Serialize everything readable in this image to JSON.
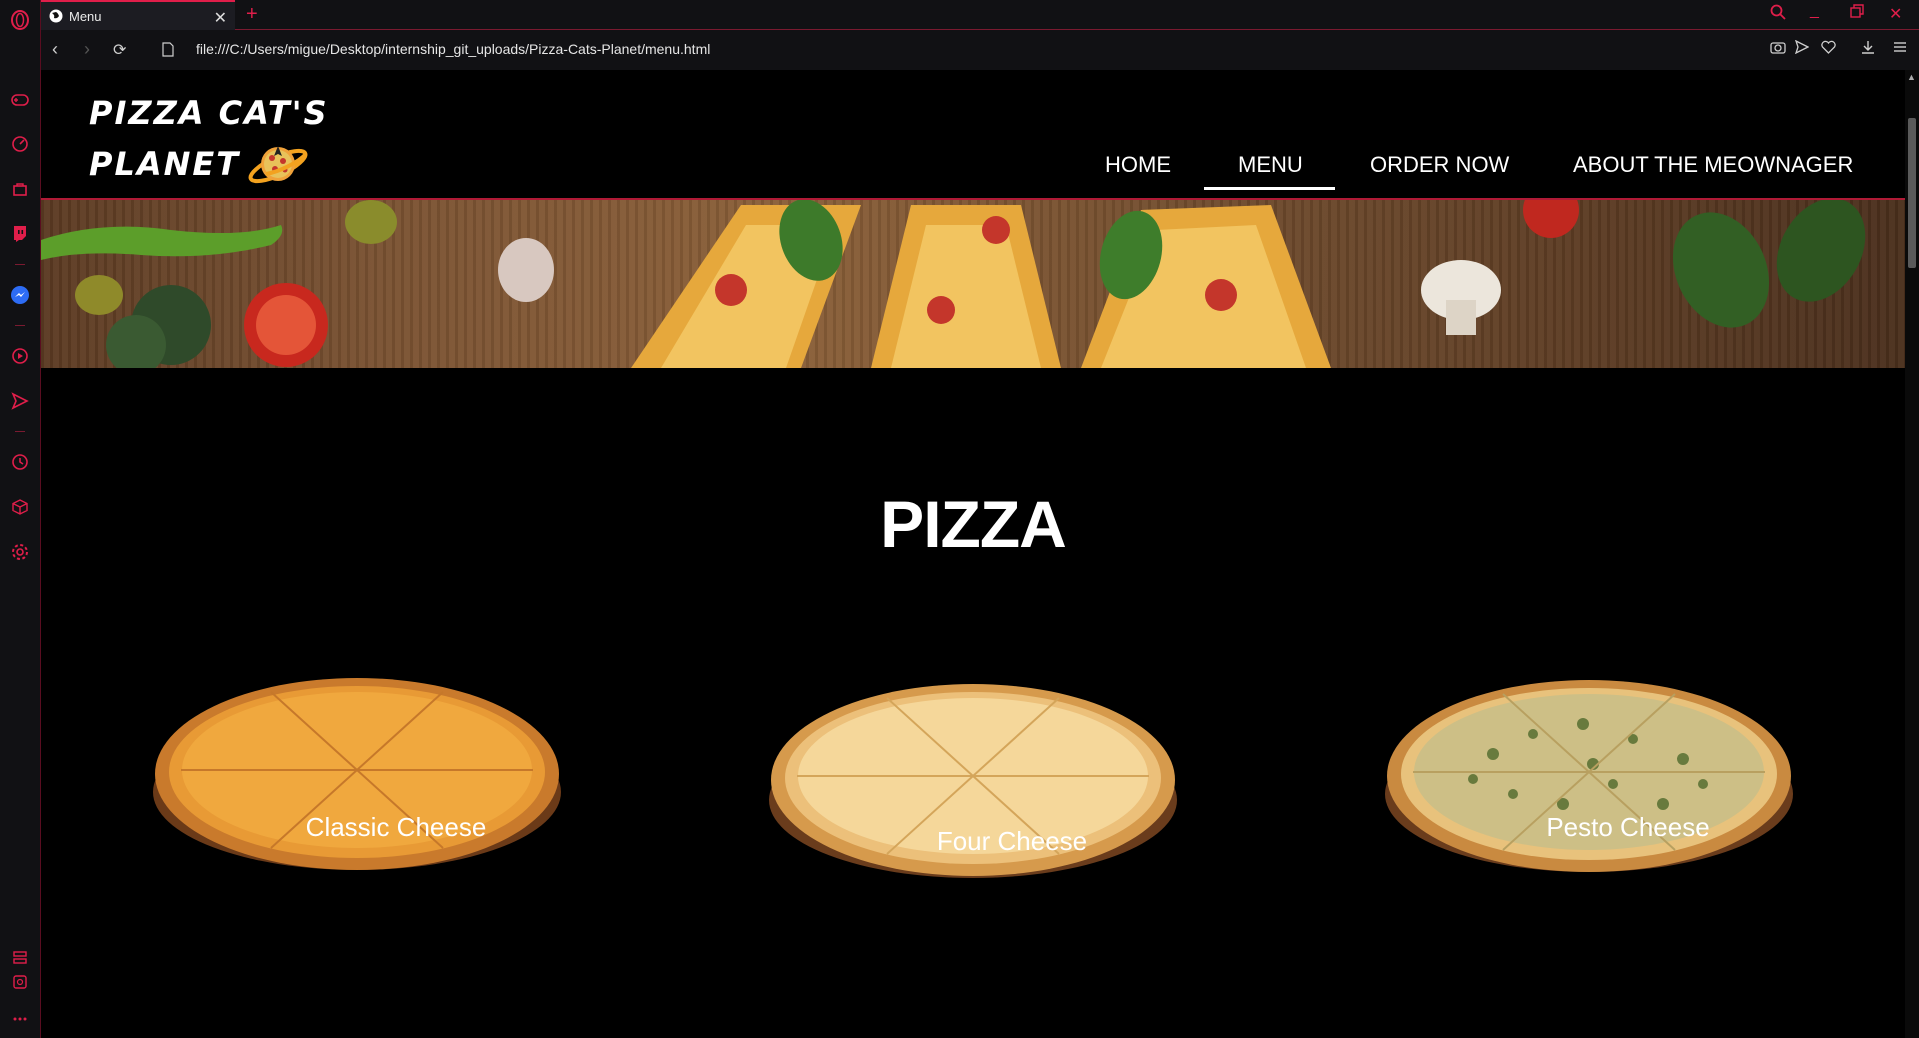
{
  "browser": {
    "tab_title": "Menu",
    "new_tab": "+",
    "url": "file:///C:/Users/migue/Desktop/internship_git_uploads/Pizza-Cats-Planet/menu.html"
  },
  "site": {
    "logo_line1": "PIZZA CAT'S",
    "logo_line2": "PLANET",
    "nav": [
      {
        "label": "HOME"
      },
      {
        "label": "MENU"
      },
      {
        "label": "ORDER NOW"
      },
      {
        "label": "ABOUT THE MEOWNAGER"
      }
    ],
    "section_title": "PIZZA",
    "pizzas": [
      {
        "name": "Classic Cheese"
      },
      {
        "name": "Four Cheese"
      },
      {
        "name": "Pesto Cheese"
      }
    ]
  },
  "colors": {
    "accent": "#e01e4a",
    "header_border": "#b01a36",
    "background": "#000000"
  }
}
